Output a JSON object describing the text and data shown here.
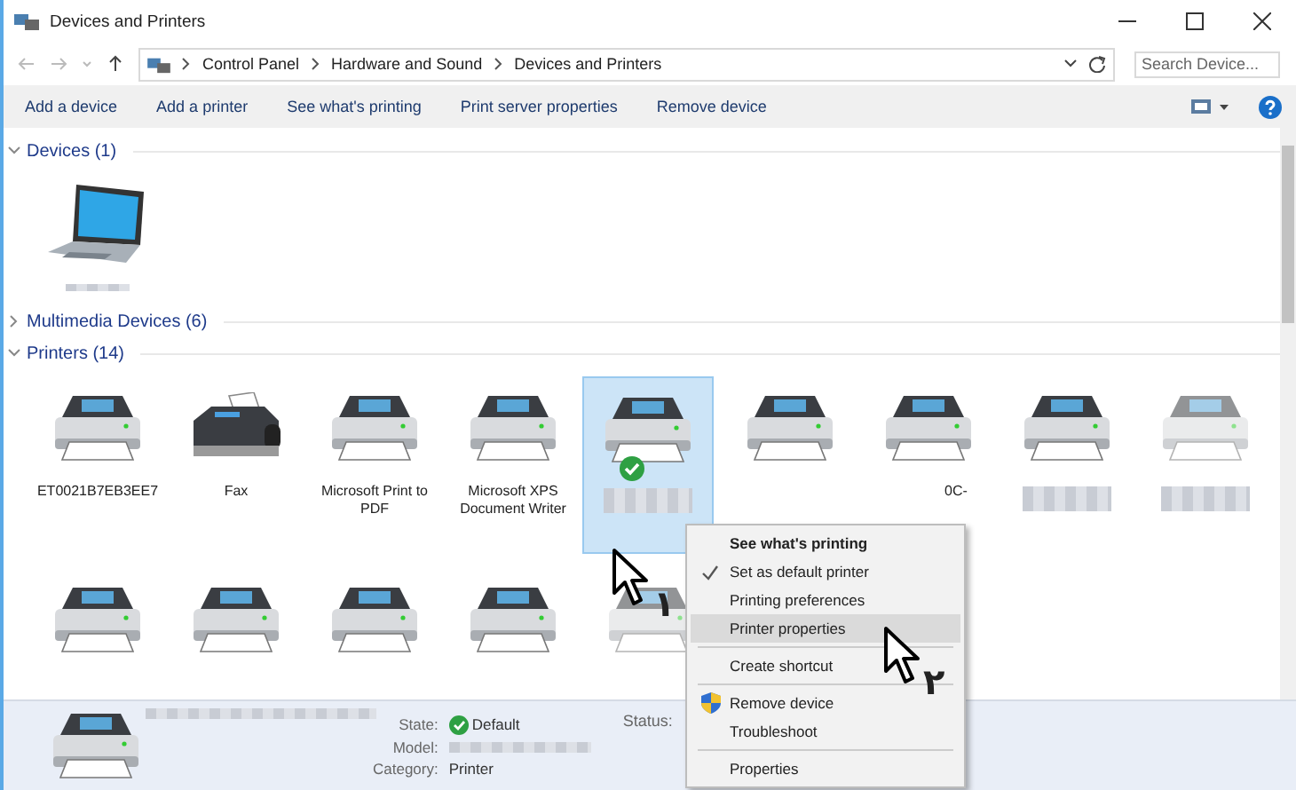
{
  "window": {
    "title": "Devices and Printers"
  },
  "address": {
    "crumbs": [
      "Control Panel",
      "Hardware and Sound",
      "Devices and Printers"
    ],
    "search_placeholder": "Search Device..."
  },
  "toolbar": [
    "Add a device",
    "Add a printer",
    "See what's printing",
    "Print server properties",
    "Remove device"
  ],
  "groups": [
    {
      "title": "Devices (1)",
      "expanded": true,
      "items": [
        {
          "kind": "laptop",
          "blurred": true,
          "selected": false,
          "dimmed": false,
          "default": false
        }
      ]
    },
    {
      "title": "Multimedia Devices (6)",
      "expanded": false
    },
    {
      "title": "Printers (14)",
      "expanded": true,
      "items": [
        {
          "kind": "printer",
          "label": "ET0021B7EB3EE7",
          "selected": false,
          "dimmed": false,
          "default": false
        },
        {
          "kind": "fax",
          "label": "Fax",
          "selected": false,
          "dimmed": false,
          "default": false
        },
        {
          "kind": "printer",
          "label": "Microsoft Print to PDF",
          "selected": false,
          "dimmed": false,
          "default": false
        },
        {
          "kind": "printer",
          "label": "Microsoft XPS Document Writer",
          "selected": false,
          "dimmed": false,
          "default": false
        },
        {
          "kind": "printer",
          "blurred": true,
          "selected": true,
          "dimmed": false,
          "default": true
        },
        {
          "kind": "printer",
          "selected": false,
          "dimmed": false,
          "default": false
        },
        {
          "kind": "printer",
          "label": "0C-",
          "clipped": true,
          "selected": false,
          "dimmed": false,
          "default": false
        },
        {
          "kind": "printer",
          "blurred": true,
          "selected": false,
          "dimmed": false,
          "default": false
        },
        {
          "kind": "printer",
          "blurred": true,
          "selected": false,
          "dimmed": true,
          "default": false
        },
        {
          "kind": "printer",
          "selected": false,
          "dimmed": false,
          "default": false
        },
        {
          "kind": "printer",
          "selected": false,
          "dimmed": false,
          "default": false
        },
        {
          "kind": "printer",
          "selected": false,
          "dimmed": false,
          "default": false
        },
        {
          "kind": "printer",
          "selected": false,
          "dimmed": false,
          "default": false
        },
        {
          "kind": "printer",
          "selected": false,
          "dimmed": true,
          "default": false
        }
      ]
    }
  ],
  "context_menu": [
    {
      "kind": "item",
      "label": "See what's printing",
      "bold": true,
      "checked": false,
      "selected": false
    },
    {
      "kind": "item",
      "label": "Set as default printer",
      "bold": false,
      "checked": true,
      "selected": false
    },
    {
      "kind": "item",
      "label": "Printing preferences",
      "bold": false,
      "checked": false,
      "selected": false
    },
    {
      "kind": "item",
      "label": "Printer properties",
      "bold": false,
      "checked": false,
      "selected": true
    },
    {
      "kind": "separator"
    },
    {
      "kind": "item",
      "label": "Create shortcut",
      "bold": false,
      "checked": false,
      "selected": false
    },
    {
      "kind": "separator"
    },
    {
      "kind": "shield",
      "label": "Remove device",
      "bold": false,
      "checked": false,
      "selected": false
    },
    {
      "kind": "item",
      "label": "Troubleshoot",
      "bold": false,
      "checked": false,
      "selected": false
    },
    {
      "kind": "separator"
    },
    {
      "kind": "item",
      "label": "Properties",
      "bold": false,
      "checked": false,
      "selected": false
    }
  ],
  "annotations": [
    "١",
    "٢"
  ],
  "details": {
    "state_label": "State:",
    "state_value": "Default",
    "model_label": "Model:",
    "category_label": "Category:",
    "category_value": "Printer",
    "status_label": "Status:"
  }
}
